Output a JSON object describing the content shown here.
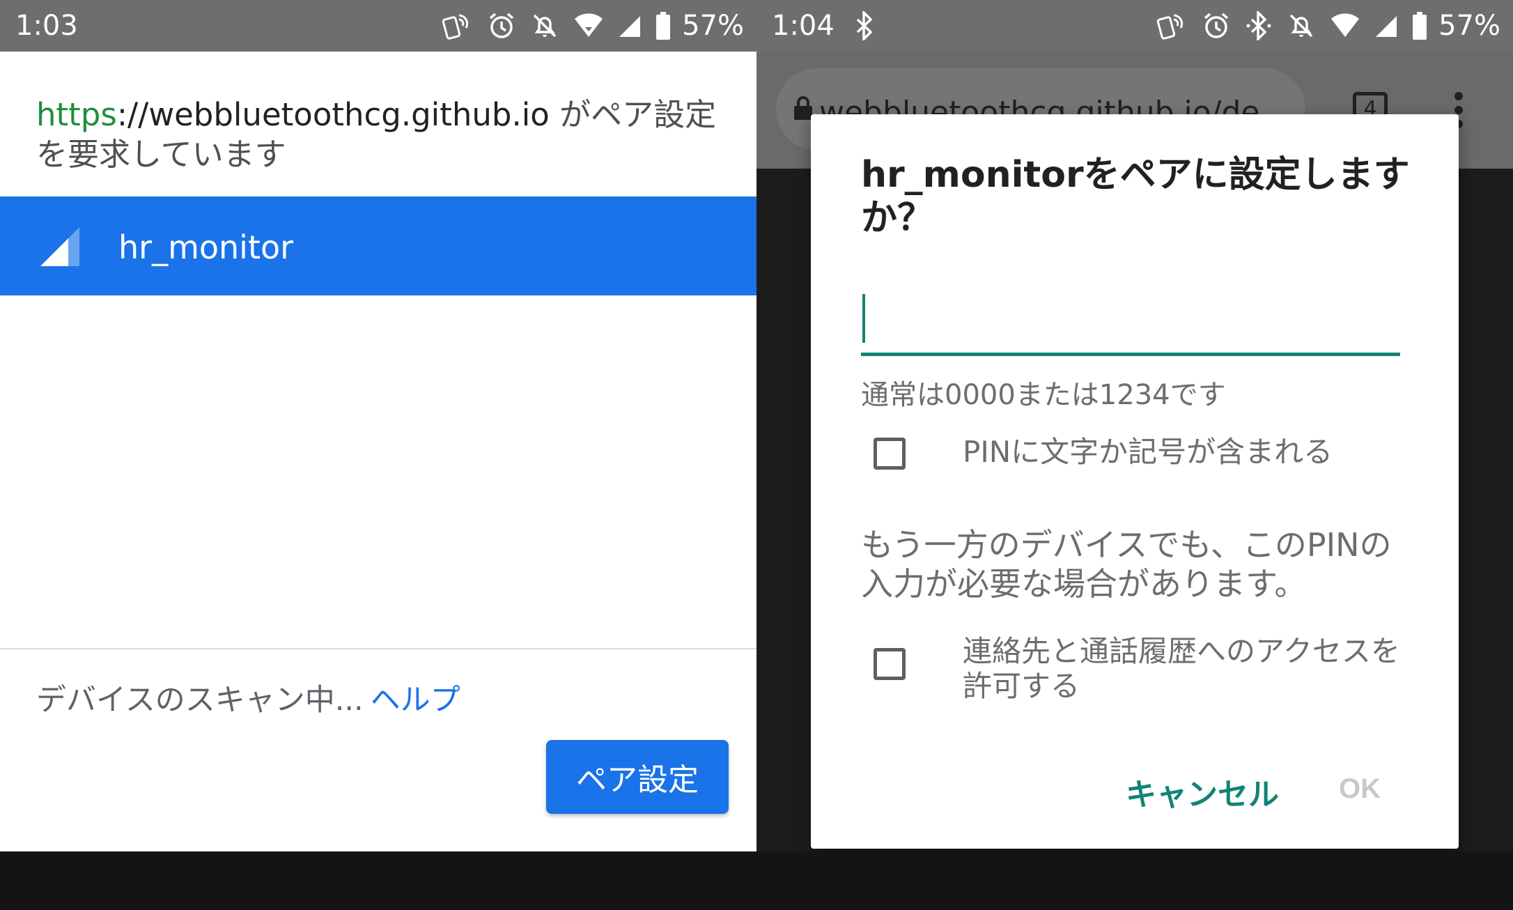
{
  "left": {
    "status_bar": {
      "time": "1:03",
      "battery": "57%"
    },
    "request": {
      "url_scheme": "https",
      "url_separator": "://",
      "url_host": "webbluetoothcg.github.io",
      "message": " がペア設定を要求しています"
    },
    "device": {
      "name": "hr_monitor"
    },
    "scanning_text": "デバイスのスキャン中...",
    "help_link": "ヘルプ",
    "pair_button": "ペア設定"
  },
  "right": {
    "status_bar": {
      "time": "1:04",
      "battery": "57%"
    },
    "browser": {
      "url": "webbluetoothcg.github.io/de",
      "tab_count": "4"
    },
    "dialog": {
      "title": "hr_monitorをペアに設定しますか？",
      "pin_value": "",
      "hint": "通常は0000または1234です",
      "checkbox_pin_label": "PINに文字か記号が含まれる",
      "info": "もう一方のデバイスでも、このPINの入力が必要な場合があります。",
      "checkbox_contacts_label": "連絡先と通話履歴へのアクセスを許可する",
      "cancel": "キャンセル",
      "ok": "OK"
    }
  },
  "colors": {
    "accent_blue": "#1a73e8",
    "teal": "#138375",
    "url_green": "#1e8e3e",
    "status_bar": "#6e6e6e"
  }
}
